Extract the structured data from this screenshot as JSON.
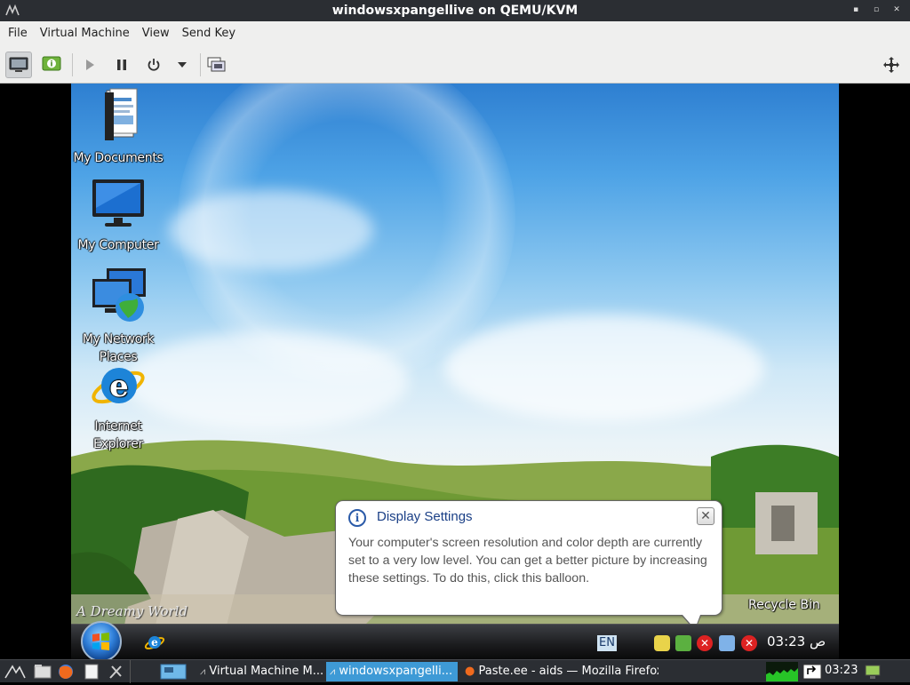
{
  "window": {
    "title": "windowsxpangellive on QEMU/KVM"
  },
  "menu": [
    "File",
    "Virtual Machine",
    "View",
    "Send Key"
  ],
  "toolbar": {
    "buttons": [
      "console-icon",
      "details-icon",
      "run-icon",
      "pause-icon",
      "power-icon",
      "dropdown-arrow-icon",
      "snapshot-icon",
      "fullscreen-icon"
    ]
  },
  "desktop": {
    "icons": [
      {
        "label": "My Documents"
      },
      {
        "label": "My Computer"
      },
      {
        "label": "My Network Places"
      },
      {
        "label": "Internet Explorer"
      }
    ],
    "recycle_label": "Recycle Bin",
    "watermark": "A Dreamy World"
  },
  "balloon": {
    "title": "Display Settings",
    "text": "Your computer's screen resolution and color depth are currently set to a very low level. You can get a better picture by increasing these settings. To do this, click this balloon.",
    "close": "✕"
  },
  "vm_taskbar": {
    "language": "EN",
    "clock": "03:23 ص"
  },
  "host_panel": {
    "tasks": [
      {
        "label": "Virtual Machine M..."
      },
      {
        "label": "windowsxpangelli..."
      },
      {
        "label": "Paste.ee - aids — Mozilla Firefox"
      }
    ],
    "clock": "03:23"
  }
}
